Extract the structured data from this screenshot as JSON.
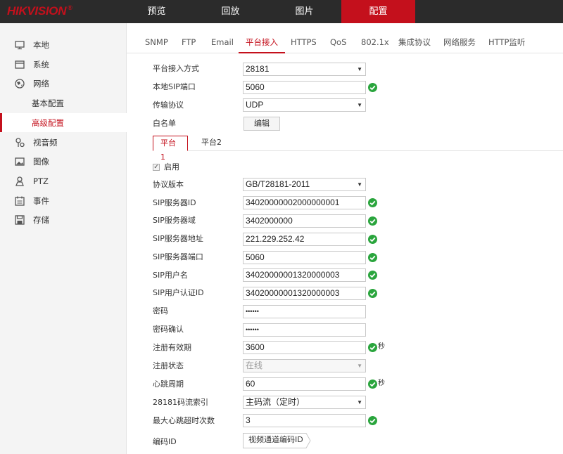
{
  "brand": {
    "logo": "HIKVISION",
    "reg": "®"
  },
  "topnav": [
    {
      "label": "预览"
    },
    {
      "label": "回放"
    },
    {
      "label": "图片"
    },
    {
      "label": "配置"
    }
  ],
  "sidebar": {
    "items": [
      {
        "label": "本地",
        "icon": "monitor-icon"
      },
      {
        "label": "系统",
        "icon": "system-icon"
      },
      {
        "label": "网络",
        "icon": "globe-icon"
      },
      {
        "label": "基本配置"
      },
      {
        "label": "高级配置"
      },
      {
        "label": "视音频",
        "icon": "audio-video-icon"
      },
      {
        "label": "图像",
        "icon": "image-icon"
      },
      {
        "label": "PTZ",
        "icon": "ptz-icon"
      },
      {
        "label": "事件",
        "icon": "event-icon"
      },
      {
        "label": "存储",
        "icon": "storage-icon"
      }
    ],
    "active_item": "高级配置",
    "accent": "#c4101c"
  },
  "tabs": [
    "SNMP",
    "FTP",
    "Email",
    "平台接入",
    "HTTPS",
    "QoS",
    "802.1x",
    "集成协议",
    "网络服务",
    "HTTP监听"
  ],
  "active_tab": "平台接入",
  "form": {
    "access_mode": {
      "label": "平台接入方式",
      "value": "28181"
    },
    "sip_port": {
      "label": "本地SIP端口",
      "value": "5060"
    },
    "transport": {
      "label": "传输协议",
      "value": "UDP"
    },
    "whitelist": {
      "label": "白名单",
      "button": "编辑"
    }
  },
  "platform_tabs": {
    "p1": "平台1",
    "p2": "平台2"
  },
  "platform": {
    "enable_label": "启用",
    "enabled": true,
    "rows": {
      "protocol": {
        "label": "协议版本",
        "value": "GB/T28181-2011"
      },
      "server_id": {
        "label": "SIP服务器ID",
        "value": "34020000002000000001"
      },
      "server_domain": {
        "label": "SIP服务器域",
        "value": "3402000000"
      },
      "server_addr": {
        "label": "SIP服务器地址",
        "value": "221.229.252.42"
      },
      "server_port": {
        "label": "SIP服务器端口",
        "value": "5060"
      },
      "username": {
        "label": "SIP用户名",
        "value": "34020000001320000003"
      },
      "auth_id": {
        "label": "SIP用户认证ID",
        "value": "34020000001320000003"
      },
      "password": {
        "label": "密码",
        "value": "••••••"
      },
      "password_confirm": {
        "label": "密码确认",
        "value": "••••••"
      },
      "reg_valid": {
        "label": "注册有效期",
        "value": "3600",
        "unit": "秒"
      },
      "reg_status": {
        "label": "注册状态",
        "value": "在线"
      },
      "heartbeat": {
        "label": "心跳周期",
        "value": "60",
        "unit": "秒"
      },
      "stream_index": {
        "label": "28181码流索引",
        "value": "主码流（定时）"
      },
      "max_timeout": {
        "label": "最大心跳超时次数",
        "value": "3"
      },
      "encode_id": {
        "label": "编码ID",
        "button": "视频通道编码ID"
      }
    }
  },
  "colors": {
    "ok": "#2aa53d",
    "accent": "#c4101c",
    "topbar": "#2b2b2b"
  }
}
